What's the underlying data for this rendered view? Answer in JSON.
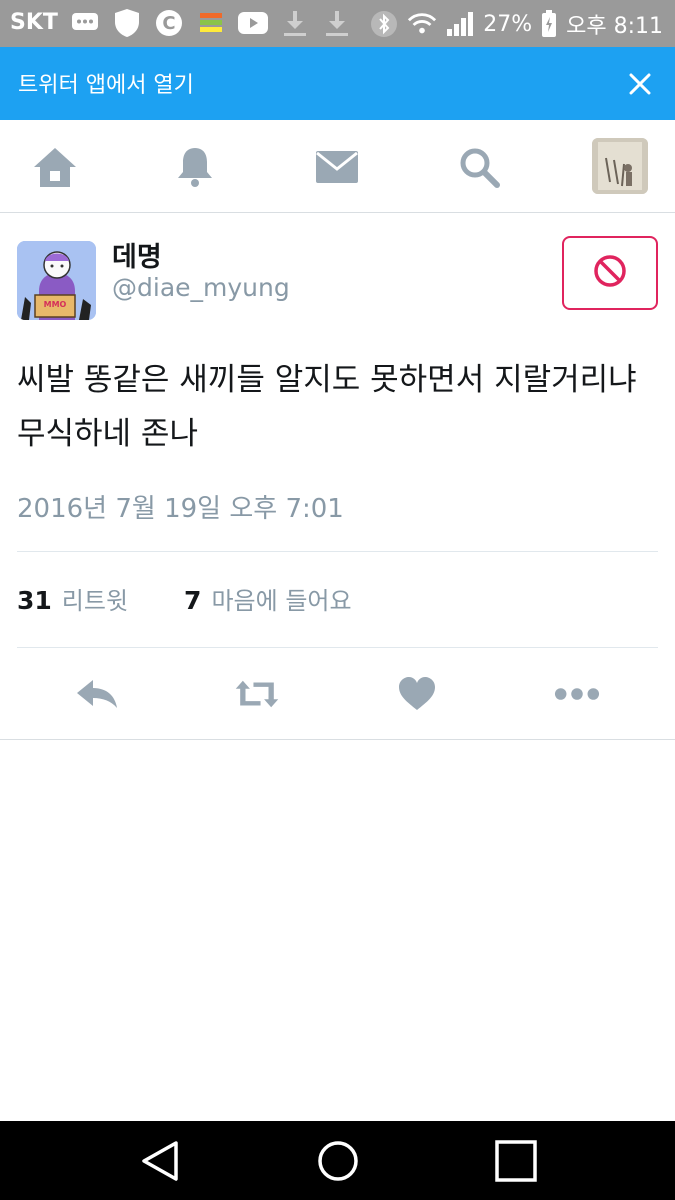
{
  "status_bar": {
    "carrier": "SKT",
    "battery": "27%",
    "time": "오후 8:11",
    "icons": [
      "chat-icon",
      "shield-icon",
      "c-icon",
      "app-icon",
      "youtube-icon",
      "download-icon",
      "download-icon",
      "bluetooth-icon",
      "wifi-icon",
      "signal-icon",
      "battery-icon"
    ]
  },
  "banner": {
    "text": "트위터 앱에서 열기",
    "close_icon": "close-icon"
  },
  "nav": {
    "items": [
      "home-icon",
      "notifications-icon",
      "messages-icon",
      "search-icon",
      "profile-avatar"
    ]
  },
  "tweet": {
    "author_name": "데명",
    "author_handle": "@diae_myung",
    "text": "씨발 똥같은 새끼들 알지도 못하면서 지랄거리냐 무식하네 존나",
    "timestamp": "2016년 7월 19일 오후 7:01",
    "retweets_count": "31",
    "retweets_label": "리트윗",
    "likes_count": "7",
    "likes_label": "마음에 들어요"
  },
  "actions": [
    "reply-icon",
    "retweet-icon",
    "like-icon",
    "more-icon"
  ],
  "colors": {
    "accent": "#1da1f2",
    "icon_gray": "#9aa8b4",
    "block_red": "#e0245e",
    "status_bar": "#9a9a9a"
  }
}
